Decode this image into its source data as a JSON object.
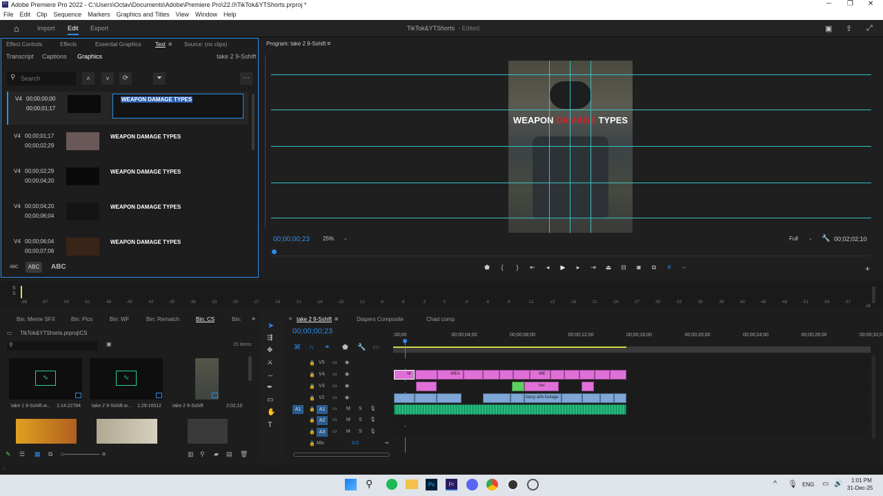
{
  "titlebar": {
    "text": "Adobe Premiere Pro 2022 - C:\\Users\\Octav\\Documents\\Adobe\\Premiere Pro\\22.0\\TikTok&YTShorts.prproj *"
  },
  "menu": [
    "File",
    "Edit",
    "Clip",
    "Sequence",
    "Markers",
    "Graphics and Titles",
    "View",
    "Window",
    "Help"
  ],
  "appbar": {
    "tabs": [
      "Import",
      "Edit",
      "Export"
    ],
    "project_name": "TikTok&YTShorts",
    "edited": "- Edited"
  },
  "left_panel": {
    "tabs": [
      "Effect Controls",
      "Effects",
      "Essential Graphics",
      "Text",
      "Source: (no clips)"
    ],
    "subtabs": [
      "Transcript",
      "Captions",
      "Graphics"
    ],
    "sequence": "take 2 9-Sshift",
    "search_placeholder": "Search",
    "captions": [
      {
        "track": "V4",
        "in": "00;00;00;00",
        "out": "00;00;01;17",
        "text": "WEAPON DAMAGE TYPES"
      },
      {
        "track": "V4",
        "in": "00;00;01;17",
        "out": "00;00;02;29",
        "text": "WEAPON DAMAGE TYPES"
      },
      {
        "track": "V4",
        "in": "00;00;02;29",
        "out": "00;00;04;20",
        "text": "WEAPON DAMAGE TYPES"
      },
      {
        "track": "V4",
        "in": "00;00;04;20",
        "out": "00;00;06;04",
        "text": "WEAPON DAMAGE TYPES"
      },
      {
        "track": "V4",
        "in": "00;00;06;04",
        "out": "00;00;07;06",
        "text": "WEAPON DAMAGE TYPES"
      }
    ],
    "case_buttons": [
      "ABC",
      "ABC",
      "ABC"
    ]
  },
  "program": {
    "title": "Program: take 2 9-Sshift",
    "overlay_parts": [
      "WEAPON ",
      "DAMAGE",
      " TYPES"
    ],
    "timecode": "00;00;00;23",
    "zoom": "25%",
    "quality": "Full",
    "duration": "00;02;02;10"
  },
  "meter": {
    "ticks": [
      "-dB",
      "-57",
      "-54",
      "-51",
      "-48",
      "-45",
      "-42",
      "-39",
      "-36",
      "-33",
      "-30",
      "-27",
      "-24",
      "-21",
      "-18",
      "-15",
      "-12",
      "-9",
      "-6",
      "-3",
      "0",
      "-3",
      "-6",
      "-9",
      "-12",
      "-15",
      "-18",
      "-21",
      "-24",
      "-27",
      "-30",
      "-33",
      "-36",
      "-39",
      "-42",
      "-45",
      "-48",
      "-51",
      "-54",
      "-57",
      "-dB"
    ]
  },
  "project": {
    "bins": [
      "Bin: Meme SFX",
      "Bin: Pics",
      "Bin: WF",
      "Bin: Rematch",
      "Bin: CS",
      "Bin:"
    ],
    "path": "TikTok&YTShorts.prproj\\CS",
    "items_count": "15 items",
    "items": [
      {
        "name": "take 1 9-Sshift.w...",
        "dur": "1:14:22784"
      },
      {
        "name": "take 2 9-Sshift.w...",
        "dur": "1:29:16512"
      },
      {
        "name": "take 2 9-Sshift",
        "dur": "2;02;10"
      }
    ]
  },
  "timeline": {
    "tabs": [
      "take 2 9-Sshift",
      "Diapers Composite",
      "Chad comp"
    ],
    "timecode": "00;00;00;23",
    "ruler": [
      ":00;00",
      "00;00;04;00",
      "00;00;08;00",
      "00;00;12;00",
      "00;00;16;00",
      "00;00;20;00",
      "00;00;24;00",
      "00;00;28;00",
      "00;00;32;0"
    ],
    "tracks": [
      "V5",
      "V4",
      "V3",
      "V2",
      "A1",
      "A2",
      "A3",
      "Mix"
    ],
    "mix_value": "0.0",
    "clip_labels": {
      "v4a": "W",
      "v4b": "WEA",
      "v4c": "WE",
      "v3a": "her",
      "v2": "fancy ahh footage"
    }
  },
  "taskbar": {
    "lang": "ENG",
    "time": "1:01 PM",
    "date": "31-Dec-25"
  },
  "colors": {
    "accent": "#2d8ceb",
    "guide": "#36c4c4",
    "pink_clip": "#e070d8",
    "blue_clip": "#7ea6d6",
    "audio_clip": "#1aa06a",
    "damage_red": "#d8202a"
  }
}
